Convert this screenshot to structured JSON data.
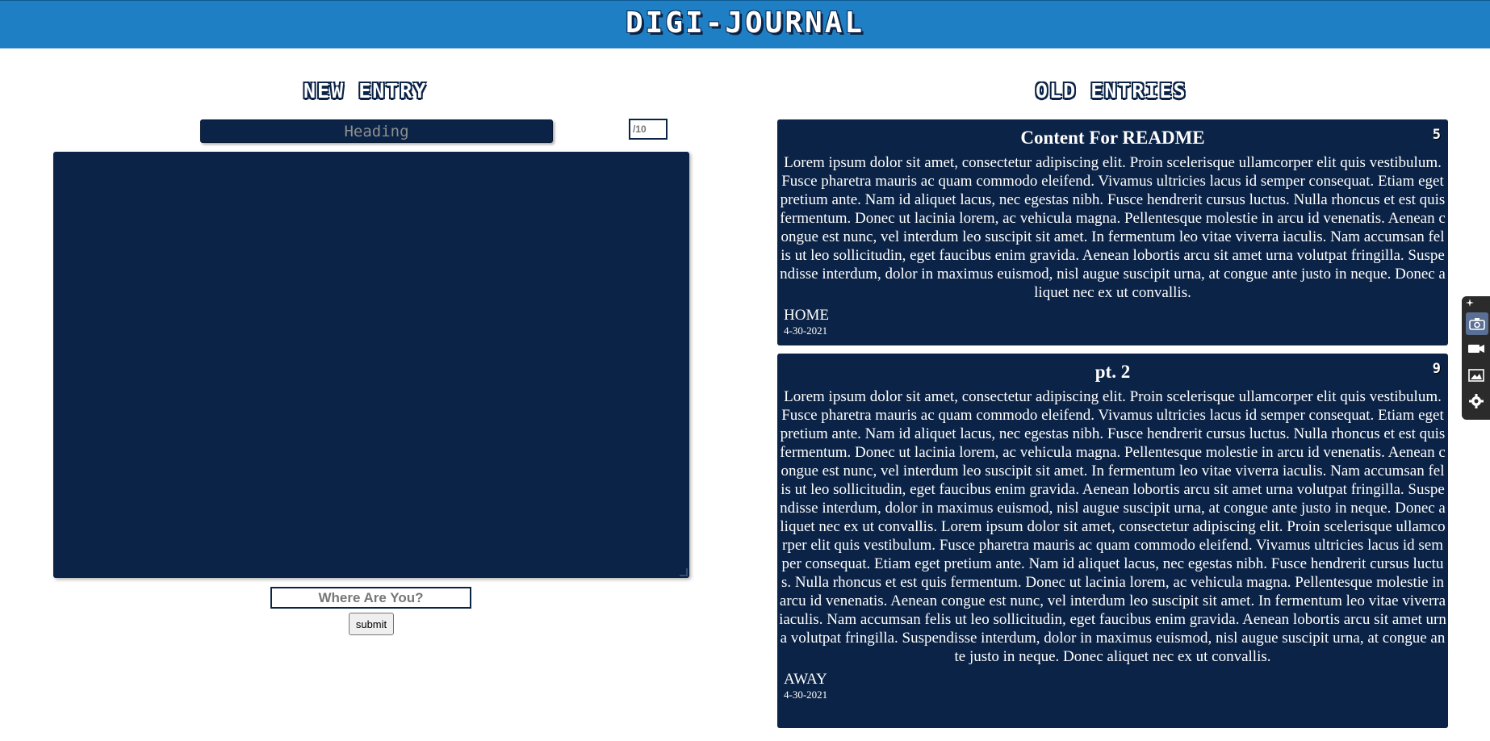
{
  "header": {
    "title": "DIGI-JOURNAL"
  },
  "new_entry": {
    "title": "NEW ENTRY",
    "heading_placeholder": "Heading",
    "rating_placeholder": "/10",
    "body_value": "",
    "location_placeholder": "Where Are You?",
    "submit_label": "submit"
  },
  "old_entries": {
    "title": "OLD ENTRIES",
    "entries": [
      {
        "heading": "Content For README",
        "rating": "5",
        "body": "Lorem ipsum dolor sit amet, consectetur adipiscing elit. Proin scelerisque ullamcorper elit quis vestibulum. Fusce pharetra mauris ac quam commodo eleifend. Vivamus ultricies lacus id semper consequat. Etiam eget pretium ante. Nam id aliquet lacus, nec egestas nibh. Fusce hendrerit cursus luctus. Nulla rhoncus et est quis fermentum. Donec ut lacinia lorem, ac vehicula magna. Pellentesque molestie in arcu id venenatis. Aenean congue est nunc, vel interdum leo suscipit sit amet. In fermentum leo vitae viverra iaculis. Nam accumsan felis ut leo sollicitudin, eget faucibus enim gravida. Aenean lobortis arcu sit amet urna volutpat fringilla. Suspendisse interdum, dolor in maximus euismod, nisl augue suscipit urna, at congue ante justo in neque. Donec aliquet nec ex ut convallis.",
        "location": "HOME",
        "date": "4-30-2021"
      },
      {
        "heading": "pt. 2",
        "rating": "9",
        "body": "Lorem ipsum dolor sit amet, consectetur adipiscing elit. Proin scelerisque ullamcorper elit quis vestibulum. Fusce pharetra mauris ac quam commodo eleifend. Vivamus ultricies lacus id semper consequat. Etiam eget pretium ante. Nam id aliquet lacus, nec egestas nibh. Fusce hendrerit cursus luctus. Nulla rhoncus et est quis fermentum. Donec ut lacinia lorem, ac vehicula magna. Pellentesque molestie in arcu id venenatis. Aenean congue est nunc, vel interdum leo suscipit sit amet. In fermentum leo vitae viverra iaculis. Nam accumsan felis ut leo sollicitudin, eget faucibus enim gravida. Aenean lobortis arcu sit amet urna volutpat fringilla. Suspendisse interdum, dolor in maximus euismod, nisl augue suscipit urna, at congue ante justo in neque. Donec aliquet nec ex ut convallis. Lorem ipsum dolor sit amet, consectetur adipiscing elit. Proin scelerisque ullamcorper elit quis vestibulum. Fusce pharetra mauris ac quam commodo eleifend. Vivamus ultricies lacus id semper consequat. Etiam eget pretium ante. Nam id aliquet lacus, nec egestas nibh. Fusce hendrerit cursus luctus. Nulla rhoncus et est quis fermentum. Donec ut lacinia lorem, ac vehicula magna. Pellentesque molestie in arcu id venenatis. Aenean congue est nunc, vel interdum leo suscipit sit amet. In fermentum leo vitae viverra iaculis. Nam accumsan felis ut leo sollicitudin, eget faucibus enim gravida. Aenean lobortis arcu sit amet urna volutpat fringilla. Suspendisse interdum, dolor in maximus euismod, nisl augue suscipit urna, at congue ante justo in neque. Donec aliquet nec ex ut convallis.",
        "location": "AWAY",
        "date": "4-30-2021"
      }
    ]
  },
  "side_toolbar": {
    "icons": [
      "pin-icon",
      "camera-icon",
      "video-icon",
      "image-icon",
      "gear-icon"
    ]
  },
  "colors": {
    "header_bg": "#1e7fc4",
    "panel_bg": "#0b2346",
    "page_bg": "#ffffff"
  }
}
